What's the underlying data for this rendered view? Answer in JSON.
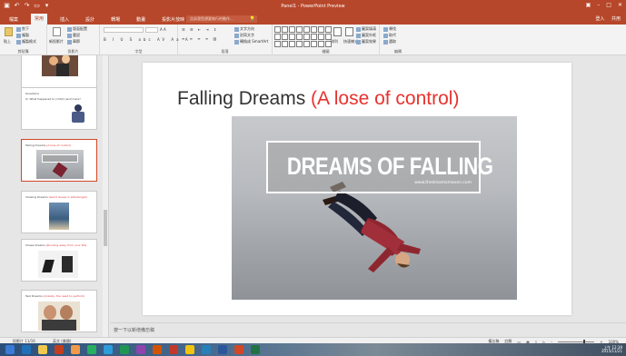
{
  "window": {
    "title": "Panel1 - PowerPoint Preview",
    "user_label": "登入",
    "share_label": "共用"
  },
  "ribbon_tabs": [
    "檔案",
    "常用",
    "插入",
    "設計",
    "轉場",
    "動畫",
    "投影片放映",
    "校閱",
    "檢視"
  ],
  "active_tab_index": 1,
  "tellme": {
    "placeholder": "告訴我您想要執行的動作..."
  },
  "ribbon": {
    "clipboard": {
      "label": "剪貼簿",
      "paste": "貼上",
      "cut": "剪下",
      "copy": "複製",
      "format_painter": "複製格式"
    },
    "slides": {
      "label": "投影片",
      "new_slide": "新投影片",
      "layout": "版面配置",
      "reset": "重設",
      "section": "章節"
    },
    "font": {
      "label": "字型"
    },
    "paragraph": {
      "label": "段落",
      "text_direction": "文字方向",
      "align_text": "對齊文字",
      "smartart": "轉換成 SmartArt"
    },
    "drawing": {
      "label": "繪圖",
      "arrange": "排列",
      "quick_styles": "快速樣式",
      "shape_fill": "圖案填滿",
      "shape_outline": "圖案外框",
      "shape_effects": "圖案效果"
    },
    "editing": {
      "label": "編輯",
      "find": "尋找",
      "replace": "取代",
      "select": "選取"
    }
  },
  "thumbnails": [
    {
      "num": "",
      "title": "",
      "title_red": "",
      "sub": ""
    },
    {
      "num": "",
      "title": "Questions",
      "title_red": "",
      "sub": "Q: What happened to (child) (and) here?"
    },
    {
      "num": "",
      "title": "Falling Dreams ",
      "title_red": "(A lose of control)",
      "sub": ""
    },
    {
      "num": "",
      "title": "Chasing Dreams ",
      "title_red": "(Avoid issues in Life/danger)",
      "sub": ""
    },
    {
      "num": "",
      "title": "Chase Dreams ",
      "title_red": "(Running away from your life)",
      "sub": ""
    },
    {
      "num": "",
      "title": "Test Dreams ",
      "title_red": "(Anxiety, the need to perform)",
      "sub": ""
    }
  ],
  "slide": {
    "title": "Falling Dreams ",
    "title_red": "(A lose of control)",
    "banner_text": "DREAMS OF FALLING",
    "banner_url": "www.thedreamsmaven.com"
  },
  "notes": {
    "placeholder": "按一下以新增備忘稿"
  },
  "status": {
    "slide_of": "投影片 11/16",
    "language": "英文 (美國)",
    "notes_btn": "備忘稿",
    "comments_btn": "註解",
    "zoom": "100%"
  },
  "tray": {
    "time": "上午 12:39",
    "date": "2015/11/21"
  },
  "colors": {
    "accent": "#b7472a",
    "title_red": "#e8322d"
  }
}
